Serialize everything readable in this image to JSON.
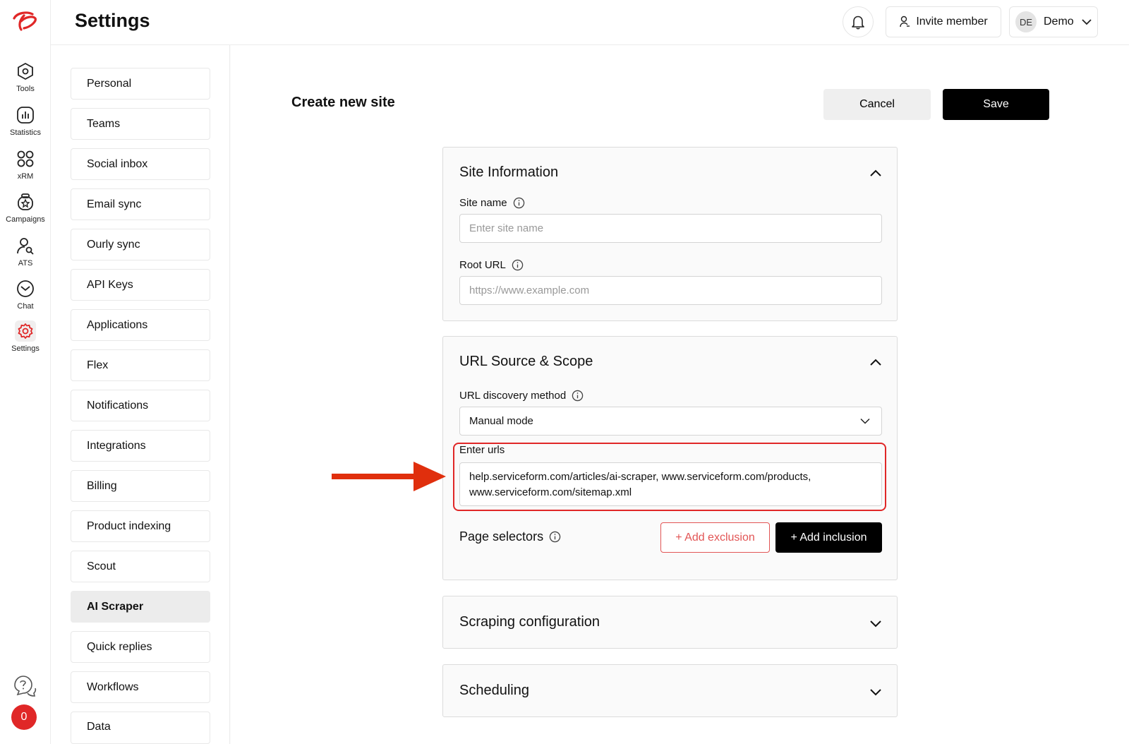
{
  "app": {
    "brand_color": "#e02727"
  },
  "rail": {
    "items": [
      {
        "label": "Tools",
        "icon": "hexagon-gear-icon"
      },
      {
        "label": "Statistics",
        "icon": "chart-icon"
      },
      {
        "label": "xRM",
        "icon": "grid-icon"
      },
      {
        "label": "Campaigns",
        "icon": "campaign-icon"
      },
      {
        "label": "ATS",
        "icon": "user-search-icon"
      },
      {
        "label": "Chat",
        "icon": "chat-icon"
      },
      {
        "label": "Settings",
        "icon": "gear-icon"
      }
    ],
    "notification_count": "0"
  },
  "header": {
    "title": "Settings",
    "invite_label": "Invite member",
    "avatar_initials": "DE",
    "account_name": "Demo"
  },
  "menu": {
    "items": [
      "Personal",
      "Teams",
      "Social inbox",
      "Email sync",
      "Ourly sync",
      "API Keys",
      "Applications",
      "Flex",
      "Notifications",
      "Integrations",
      "Billing",
      "Product indexing",
      "Scout",
      "AI Scraper",
      "Quick replies",
      "Workflows",
      "Data"
    ],
    "active": "AI Scraper"
  },
  "form": {
    "title": "Create new site",
    "cancel_label": "Cancel",
    "save_label": "Save"
  },
  "site_info": {
    "title": "Site Information",
    "site_name_label": "Site name",
    "site_name_placeholder": "Enter site name",
    "root_url_label": "Root URL",
    "root_url_placeholder": "https://www.example.com"
  },
  "url_source": {
    "title": "URL Source & Scope",
    "discovery_label": "URL discovery method",
    "discovery_value": "Manual mode",
    "urls_label": "Enter urls",
    "urls_line1": "help.serviceform.com/articles/ai-scraper, www.serviceform.com/products,",
    "urls_line2": "www.serviceform.com/sitemap.xml",
    "page_selectors_label": "Page selectors",
    "add_exclusion_label": "+ Add exclusion",
    "add_inclusion_label": "+ Add inclusion"
  },
  "sections": {
    "scraping_title": "Scraping configuration",
    "scheduling_title": "Scheduling"
  }
}
